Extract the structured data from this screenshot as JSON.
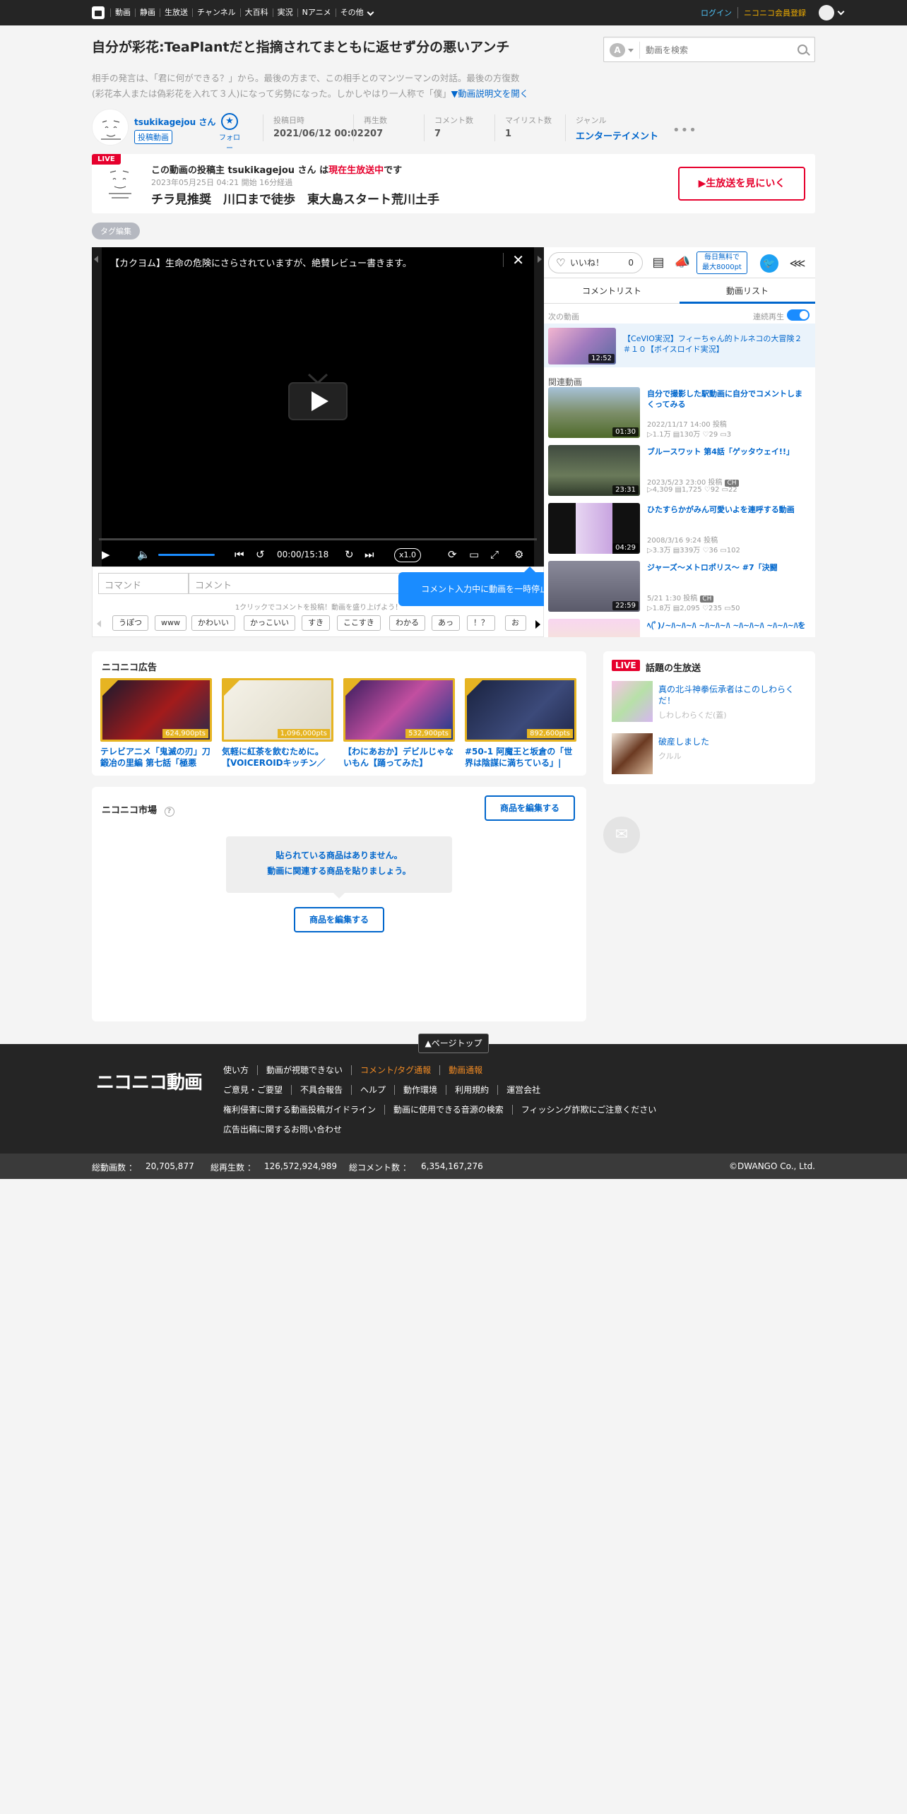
{
  "topbar": {
    "items": [
      "動画",
      "静画",
      "生放送",
      "チャンネル",
      "大百科",
      "実況",
      "Nアニメ",
      "その他"
    ],
    "login": "ログイン",
    "register": "ニコニコ会員登録"
  },
  "video": {
    "title": "自分が彩花:TeaPlantだと指摘されてまともに返せず分の悪いアンチ",
    "description_line1": "相手の発言は、「君に何ができる？」から。最後の方まで、この相手とのマンツーマンの対話。最後の方復数",
    "description_line2": "(彩花本人または偽彩花を入れて３人)になって劣勢になった。しかしやはり一人称で「僕」",
    "description_more": "▼動画説明文を開く",
    "owner": "tsukikagejou さん",
    "owner_badge": "投稿動画",
    "follow": "フォロー",
    "meta": [
      {
        "label": "投稿日時",
        "value": "2021/06/12 00:02"
      },
      {
        "label": "再生数",
        "value": "207"
      },
      {
        "label": "コメント数",
        "value": "7"
      },
      {
        "label": "マイリスト数",
        "value": "1"
      },
      {
        "label": "ジャンル",
        "value": "エンターテイメント"
      }
    ]
  },
  "search": {
    "placeholder": "動画を検索",
    "mode": "A"
  },
  "live_banner": {
    "badge": "LIVE",
    "line1_pre": "この動画の投稿主 tsukikagejou さん は",
    "line1_red": "現在生放送中",
    "line1_post": "です",
    "started": "2023年05月25日 04:21 開始  16分経過",
    "title": "チラ見推奨　川口まで徒歩　東大島スタート荒川土手",
    "button": "▶生放送を見にいく"
  },
  "tag_edit": "タグ編集",
  "player": {
    "ad_title": "【カクヨム】生命の危険にさらされていますが、絶賛レビュー書きます。",
    "time": "00:00/15:18",
    "speed": "x1.0"
  },
  "comment": {
    "command_placeholder": "コマンド",
    "comment_placeholder": "コメント",
    "hint": "1クリックでコメントを投稿！動画を盛り上げよう！",
    "quick_tags": [
      "うぽつ",
      "www",
      "かわいい",
      "かっこいい",
      "すき",
      "ここすき",
      "わかる",
      "あっ",
      "！？",
      "お"
    ],
    "tooltip": "コメント入力中に動画を一時停止できるようになりました"
  },
  "right_panel": {
    "like_label": "いいね！",
    "like_count": "0",
    "free_line1": "毎日無料で",
    "free_line2": "最大8000pt",
    "tabs": [
      "コメントリスト",
      "動画リスト"
    ],
    "next_label": "次の動画",
    "continuous": "連続再生",
    "next_video": {
      "title": "【CeVIO実況】フィーちゃん的トルネコの大冒険２＃１０【ボイスロイド実況】",
      "duration": "12:52"
    },
    "related_label": "関連動画",
    "related": [
      {
        "title": "自分で撮影した駅動画に自分でコメントしまくってみる",
        "date": "2022/11/17 14:00 投稿",
        "stats": "▷1.1万  ▤130万  ♡29  ▭3",
        "duration": "01:30",
        "ch": false
      },
      {
        "title": "ブルースワット 第4話「ゲッタウェイ!!」",
        "date": "2023/5/23 23:00 投稿",
        "stats": "▷4,309  ▤1,725  ♡92  ▭22",
        "duration": "23:31",
        "ch": true
      },
      {
        "title": "ひたすらかがみん可愛いよを連呼する動画",
        "date": "2008/3/16 9:24 投稿",
        "stats": "▷3.3万  ▤339万  ♡36  ▭102",
        "duration": "04:29",
        "ch": false
      },
      {
        "title": "ジャーズ～メトロポリス～ #7「決闘",
        "date": "5/21 1:30 投稿",
        "stats": "▷1.8万  ▤2,095  ♡235  ▭50",
        "duration": "22:59",
        "ch": true
      },
      {
        "title": "ﾍ(ﾟ)ﾉ~ﾊ~ﾊ~ﾊ ~ﾊ~ﾊ~ﾊ ~ﾊ~ﾊ~ﾊ ~ﾊ~ﾊ~ﾊを",
        "date": "",
        "stats": "",
        "duration": "",
        "ch": false
      }
    ],
    "ch_label": "CH"
  },
  "ads": {
    "title": "ニコニコ広告",
    "items": [
      {
        "caption": "テレビアニメ「鬼滅の刃」刀鍛冶の里編 第七話「極悪",
        "pts": "624,900pts"
      },
      {
        "caption": "気軽に紅茶を飲むために。【VOICEROIDキッチン／",
        "pts": "1,096,000pts"
      },
      {
        "caption": "【わにあおか】デビルじゃないもん【踊ってみた】",
        "pts": "532,900pts"
      },
      {
        "caption": "#50-1 阿魔王と坂倉の「世界は陰謀に満ちている」|",
        "pts": "892,600pts"
      }
    ]
  },
  "market": {
    "title": "ニコニコ市場",
    "edit": "商品を編集する",
    "empty_line1": "貼られている商品はありません。",
    "empty_line2": "動画に関連する商品を貼りましょう。"
  },
  "live_topics": {
    "badge": "LIVE",
    "title": "話題の生放送",
    "items": [
      {
        "title": "真の北斗神拳伝承者はこのしわらくだ！",
        "sub": "しわしわらくだ(蓋)"
      },
      {
        "title": "破産しました",
        "sub": "クルル"
      }
    ]
  },
  "footer": {
    "pagetop": "▲ページトップ",
    "logo": "ニコニコ動画",
    "row1": [
      "使い方",
      "動画が視聴できない",
      "コメント/タグ通報",
      "動画通報"
    ],
    "row2": [
      "ご意見・ご要望",
      "不具合報告",
      "ヘルプ",
      "動作環境",
      "利用規約",
      "運営会社"
    ],
    "row3": [
      "権利侵害に関する動画投稿ガイドライン",
      "動画に使用できる音源の検索",
      "フィッシング詐欺にご注意ください"
    ],
    "row4": [
      "広告出稿に関するお問い合わせ"
    ]
  },
  "stats": {
    "videos_label": "総動画数 ：",
    "videos": "20,705,877",
    "plays_label": "総再生数 ：",
    "plays": "126,572,924,989",
    "comments_label": "総コメント数 ：",
    "comments": "6,354,167,276",
    "copyright": "©DWANGO Co., Ltd."
  },
  "colors": {
    "accent": "#0066cc",
    "live_red": "#e6002d",
    "ad_gold": "#e6b422",
    "toggle_blue": "#1a8cff"
  }
}
